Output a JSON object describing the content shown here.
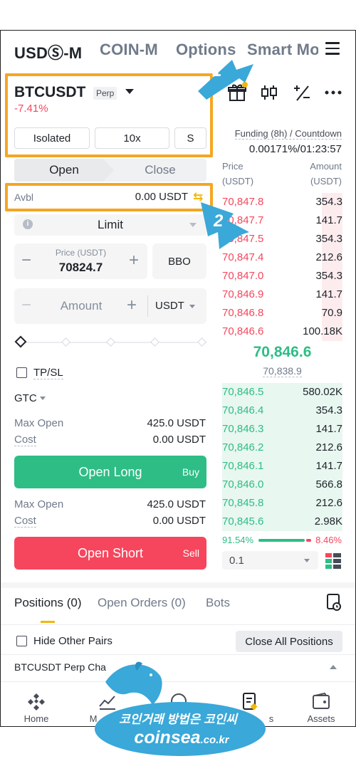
{
  "header": {
    "tabs": [
      "USDⓈ-M",
      "COIN-M",
      "Options",
      "Smart Mo"
    ]
  },
  "symbol": {
    "name": "BTCUSDT",
    "badge": "Perp",
    "change": "-7.41%"
  },
  "settings": {
    "margin_mode": "Isolated",
    "leverage": "10x",
    "asset_mode": "S"
  },
  "order_side": {
    "open": "Open",
    "close": "Close"
  },
  "available": {
    "label": "Avbl",
    "value": "0.00 USDT"
  },
  "order_type": {
    "selected": "Limit"
  },
  "price_input": {
    "label": "Price (USDT)",
    "value": "70824.7",
    "bbo": "BBO"
  },
  "amount_input": {
    "placeholder": "Amount",
    "unit": "USDT"
  },
  "tpsl": {
    "label": "TP/SL"
  },
  "tif": {
    "selected": "GTC"
  },
  "long": {
    "max_open_label": "Max Open",
    "max_open_value": "425.0 USDT",
    "cost_label": "Cost",
    "cost_value": "0.00 USDT",
    "button": "Open Long",
    "button_sub": "Buy"
  },
  "short": {
    "max_open_label": "Max Open",
    "max_open_value": "425.0 USDT",
    "cost_label": "Cost",
    "cost_value": "0.00 USDT",
    "button": "Open Short",
    "button_sub": "Sell"
  },
  "funding": {
    "label": "Funding (8h) / Countdown",
    "value": "0.00171%/01:23:57"
  },
  "orderbook": {
    "price_header": "Price",
    "price_unit": "(USDT)",
    "amount_header": "Amount",
    "amount_unit": "(USDT)",
    "asks": [
      {
        "price": "70,847.8",
        "amount": "354.3",
        "depth": 0.17
      },
      {
        "price": "70,847.7",
        "amount": "141.7",
        "depth": 0.17
      },
      {
        "price": "70,847.5",
        "amount": "354.3",
        "depth": 0.17
      },
      {
        "price": "70,847.4",
        "amount": "212.6",
        "depth": 0.17
      },
      {
        "price": "70,847.0",
        "amount": "354.3",
        "depth": 0.17
      },
      {
        "price": "70,846.9",
        "amount": "141.7",
        "depth": 0.17
      },
      {
        "price": "70,846.8",
        "amount": "70.9",
        "depth": 0.17
      },
      {
        "price": "70,846.6",
        "amount": "100.18K",
        "depth": 0.17
      }
    ],
    "last_price": "70,846.6",
    "mark_price": "70,838.9",
    "bids": [
      {
        "price": "70,846.5",
        "amount": "580.02K",
        "depth": 1.0
      },
      {
        "price": "70,846.4",
        "amount": "354.3",
        "depth": 1.0
      },
      {
        "price": "70,846.3",
        "amount": "141.7",
        "depth": 1.0
      },
      {
        "price": "70,846.2",
        "amount": "212.6",
        "depth": 1.0
      },
      {
        "price": "70,846.1",
        "amount": "141.7",
        "depth": 1.0
      },
      {
        "price": "70,846.0",
        "amount": "566.8",
        "depth": 1.0
      },
      {
        "price": "70,845.8",
        "amount": "212.6",
        "depth": 1.0
      },
      {
        "price": "70,845.6",
        "amount": "2.98K",
        "depth": 1.0
      }
    ],
    "buy_ratio": "91.54%",
    "sell_ratio": "8.46%",
    "precision": "0.1"
  },
  "positions_tabs": {
    "positions": "Positions (0)",
    "orders": "Open Orders (0)",
    "bots": "Bots"
  },
  "positions": {
    "hide_label": "Hide Other Pairs",
    "close_all": "Close All Positions",
    "pair_row": "BTCUSDT Perp Cha"
  },
  "nav": {
    "items": [
      "Home",
      "M",
      "",
      "s",
      "Assets"
    ]
  },
  "callouts": [
    "1",
    "2"
  ],
  "watermark": {
    "line1": "코인거래 방법은 코인씨",
    "line2": "coinsea",
    "line2_suffix": ".co.kr"
  },
  "colors": {
    "green": "#2ebd85",
    "red": "#f6465d",
    "accent": "#f0b90b",
    "callout": "#f5a623"
  }
}
